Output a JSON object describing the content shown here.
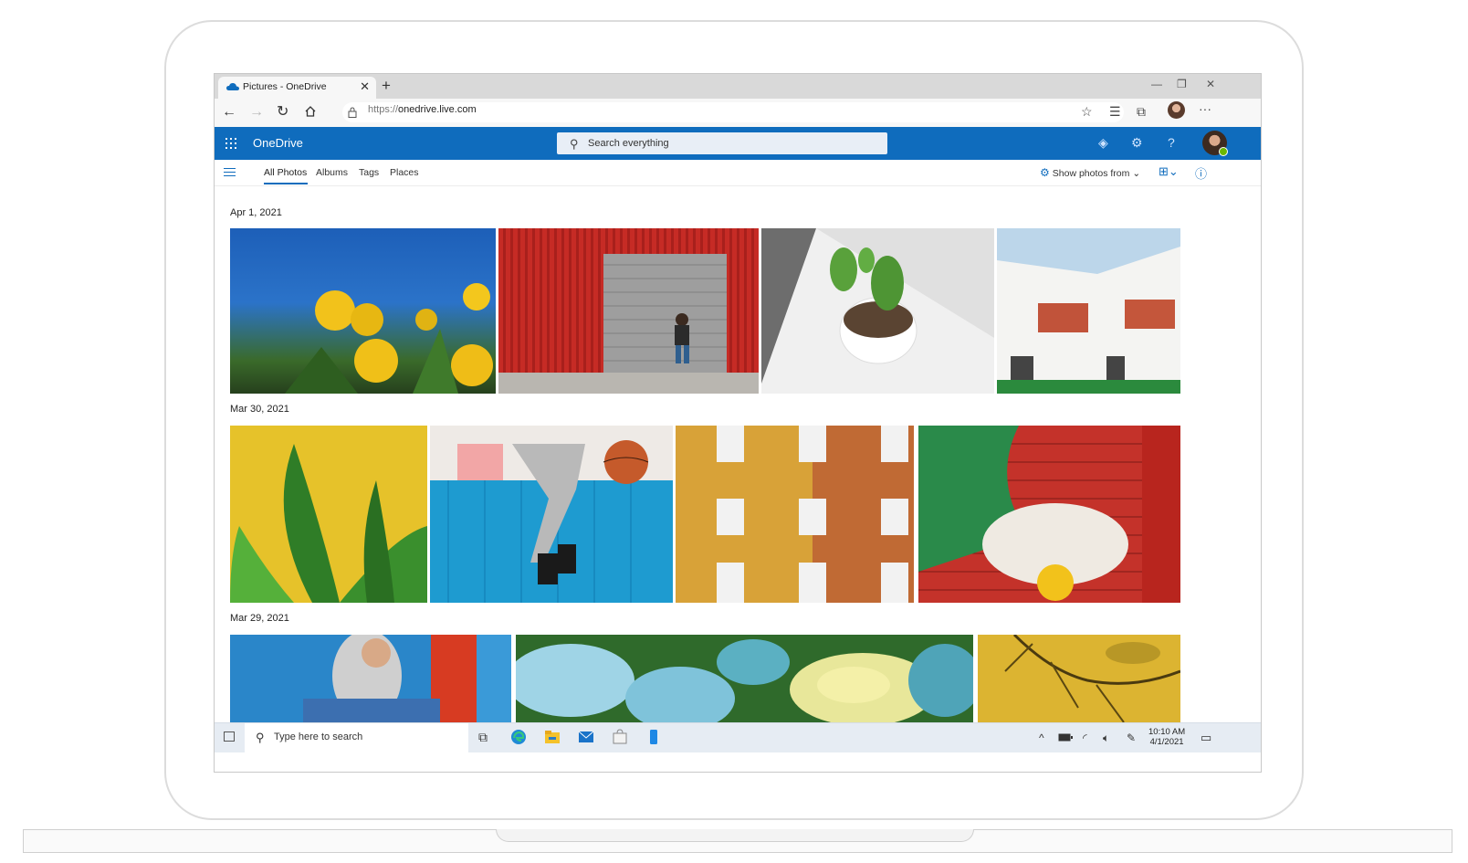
{
  "browser": {
    "tab_title": "Pictures - OneDrive",
    "tab_close": "✕",
    "new_tab": "+",
    "url_protocol": "https://",
    "url_host": "onedrive.live.com",
    "win_min": "—",
    "win_restore": "❐",
    "win_close": "✕",
    "more": "···"
  },
  "header": {
    "brand": "OneDrive",
    "search_placeholder": "Search everything"
  },
  "photo_tabs": [
    "All Photos",
    "Albums",
    "Tags",
    "Places"
  ],
  "show_photos_from": "Show photos from",
  "groups": [
    {
      "date": "Apr 1, 2021"
    },
    {
      "date": "Mar 30, 2021"
    },
    {
      "date": "Mar 29, 2021"
    }
  ],
  "taskbar": {
    "search_placeholder": "Type here to search",
    "time": "10:10 AM",
    "date": "4/1/2021"
  },
  "colors": {
    "brand_blue": "#0f6cbd",
    "header_bg": "#0f6cbd",
    "taskbar_bg": "#e6ecf3"
  }
}
